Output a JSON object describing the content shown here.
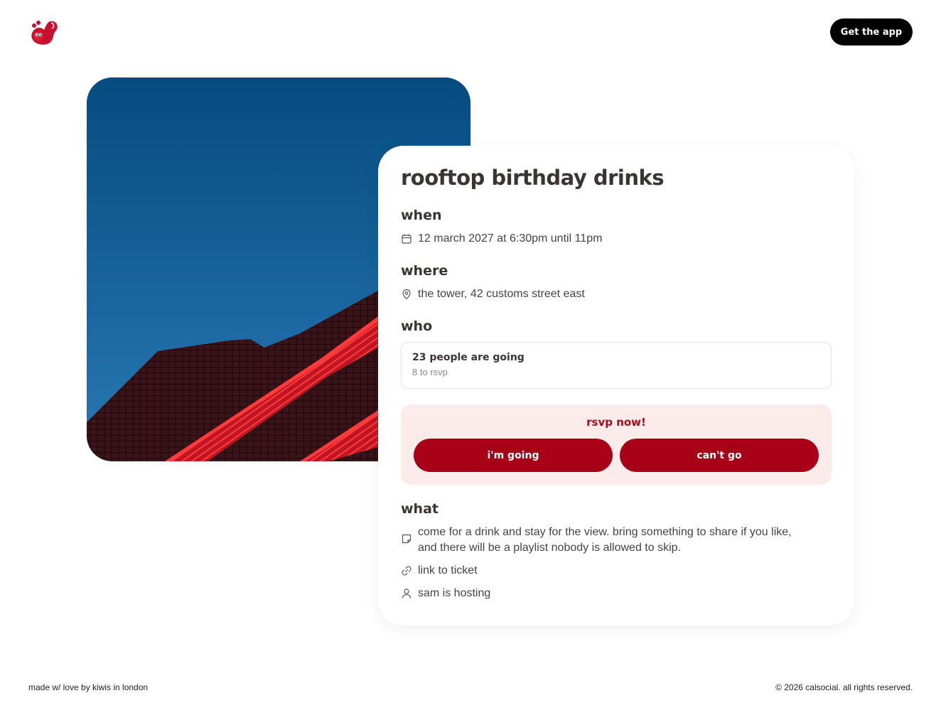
{
  "header": {
    "logo_icon": "squirrel-logo-icon",
    "get_app_label": "Get the app"
  },
  "hero": {
    "image_icon": "red-rooftop-sky-photo"
  },
  "event": {
    "title": "rooftop birthday drinks",
    "when": {
      "heading": "when",
      "icon": "calendar-icon",
      "text": "12 march 2027 at 6:30pm until 11pm"
    },
    "where": {
      "heading": "where",
      "icon": "map-pin-icon",
      "text": "the tower, 42 customs street east"
    },
    "who": {
      "heading": "who",
      "count_text": "23 people are going",
      "sub_text": "8 to rsvp"
    },
    "rsvp": {
      "title": "rsvp now!",
      "going_label": "i'm going",
      "cant_label": "can't go"
    },
    "what": {
      "heading": "what",
      "description_icon": "note-icon",
      "description_line1": "come for a drink and stay for the view. bring something to share if you like,",
      "description_line2": "and there will be a playlist nobody is allowed to skip.",
      "ticket_icon": "link-icon",
      "ticket_label": "link to ticket",
      "host_icon": "user-icon",
      "host_text": "sam is hosting"
    }
  },
  "colors": {
    "accent": "#a80016",
    "rsvp_bg": "#fcebeb",
    "button_dark": "#000000"
  },
  "footer": {
    "left": "made w/ love by kiwis in london",
    "right": "© 2026 calsocial. all rights reserved."
  }
}
